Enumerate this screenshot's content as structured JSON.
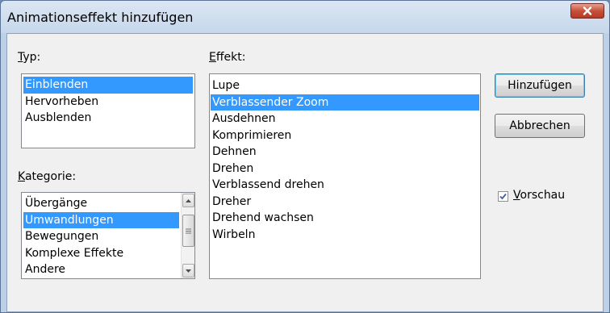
{
  "dialog": {
    "title": "Animationseffekt hinzufügen"
  },
  "typ": {
    "label_accel": "T",
    "label_rest": "yp:",
    "items": [
      "Einblenden",
      "Hervorheben",
      "Ausblenden"
    ],
    "selected": "Einblenden"
  },
  "kategorie": {
    "label_accel": "K",
    "label_rest": "ategorie:",
    "items": [
      "Übergänge",
      "Umwandlungen",
      "Bewegungen",
      "Komplexe Effekte",
      "Andere"
    ],
    "selected": "Umwandlungen"
  },
  "effekt": {
    "label_accel": "E",
    "label_rest": "ffekt:",
    "items": [
      "Lupe",
      "Verblassender Zoom",
      "Ausdehnen",
      "Komprimieren",
      "Dehnen",
      "Drehen",
      "Verblassend drehen",
      "Dreher",
      "Drehend wachsen",
      "Wirbeln"
    ],
    "selected": "Verblassender Zoom"
  },
  "buttons": {
    "add": "Hinzufügen",
    "cancel": "Abbrechen"
  },
  "preview": {
    "label_accel": "V",
    "label_rest": "orschau",
    "checked": true
  },
  "colors": {
    "selection": "#3399ff",
    "close_button": "#c7503a"
  },
  "icons": {
    "close": "close-icon",
    "scroll_up": "chevron-up-icon",
    "scroll_down": "chevron-down-icon",
    "thumb_grip": "grip-icon",
    "checkmark": "checkmark-icon"
  }
}
